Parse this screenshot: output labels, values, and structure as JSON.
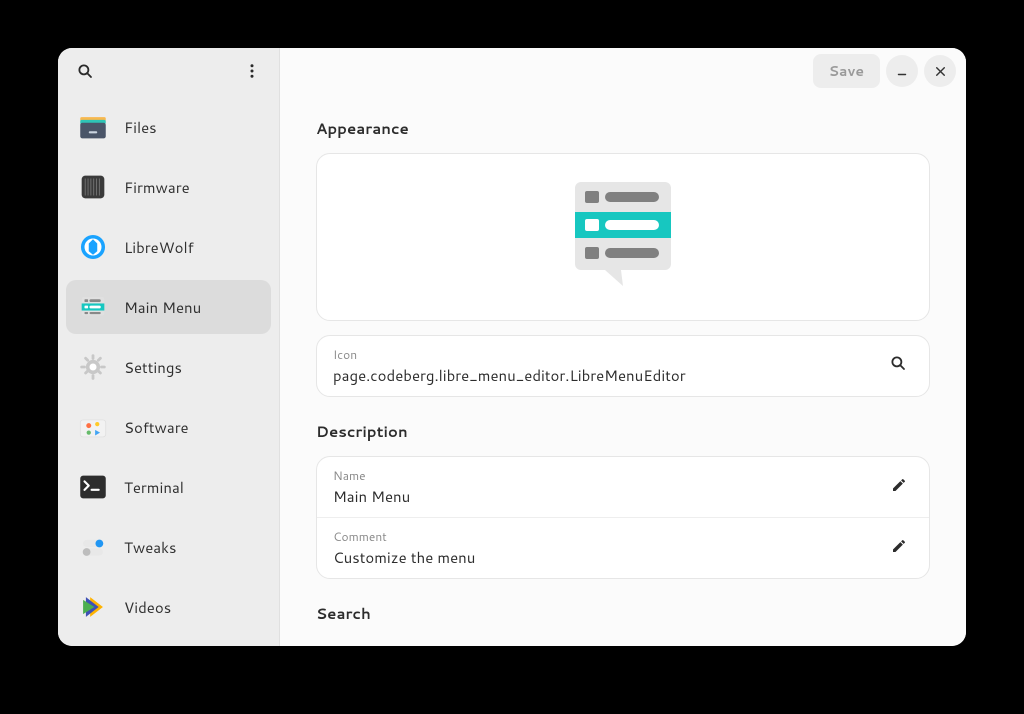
{
  "header": {
    "save_label": "Save"
  },
  "sidebar": {
    "items": [
      {
        "label": "Files"
      },
      {
        "label": "Firmware"
      },
      {
        "label": "LibreWolf"
      },
      {
        "label": "Main Menu"
      },
      {
        "label": "Settings"
      },
      {
        "label": "Software"
      },
      {
        "label": "Terminal"
      },
      {
        "label": "Tweaks"
      },
      {
        "label": "Videos"
      }
    ],
    "selected_index": 3
  },
  "sections": {
    "appearance_title": "Appearance",
    "icon_label": "Icon",
    "icon_value": "page.codeberg.libre_menu_editor.LibreMenuEditor",
    "description_title": "Description",
    "name_label": "Name",
    "name_value": "Main Menu",
    "comment_label": "Comment",
    "comment_value": "Customize the menu",
    "search_title": "Search"
  }
}
